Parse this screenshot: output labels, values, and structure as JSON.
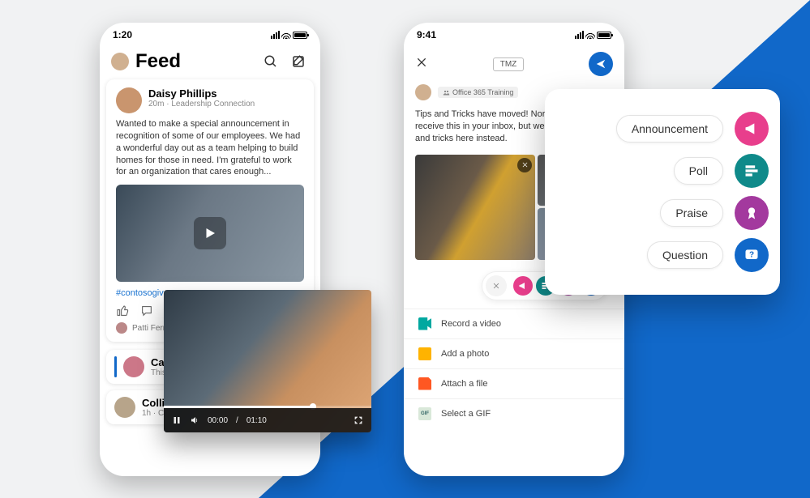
{
  "left": {
    "statusTime": "1:20",
    "headerTitle": "Feed",
    "post": {
      "author": "Daisy Phillips",
      "meta": "20m · Leadership Connection",
      "body": "Wanted to make a special announcement in recognition of some of our employees. We had a wonderful day out as a team helping to build homes for those in need. I'm grateful to work for an organization that cares enough...",
      "hashtag": "#contosogives",
      "likedBy": "Patti Fernandez, C"
    },
    "threadPeek": {
      "author": "Caro",
      "preview": "This"
    },
    "nextPost": {
      "author": "Collin Ballinger",
      "meta": "1h · Contoso HR"
    }
  },
  "video": {
    "current": "00:00",
    "total": "01:10"
  },
  "right": {
    "statusTime": "9:41",
    "topTag": "TMZ",
    "groupChip": "Office 365 Training",
    "composeText": "Tips and Tricks have moved! Normally you might receive this in your inbox, but we share O365 tips and tricks here instead.",
    "attachments": {
      "video": "Record a video",
      "photo": "Add a photo",
      "file": "Attach a file",
      "gif": "Select a GIF"
    }
  },
  "postTypes": {
    "announcement": "Announcement",
    "poll": "Poll",
    "praise": "Praise",
    "question": "Question"
  }
}
